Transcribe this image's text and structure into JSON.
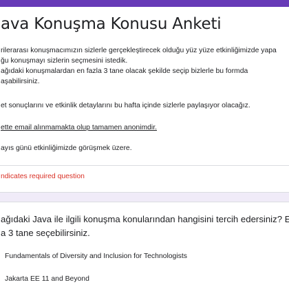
{
  "form": {
    "title": "ava Konuşma Konusu Anketi",
    "description_lines": [
      "rilerarası konuşmacımızın sizlerle gerçekleştirecek olduğu yüz yüze etkinliğimizde yapa",
      "ğu konuşmayı sizlerin seçmesini istedik.",
      "ağıdaki konuşmalardan en fazla 3 tane olacak şekilde seçip bizlerle bu formda",
      "aşabilirsiniz.",
      "et sonuçlarını ve etkinlik detaylarını bu hafta içinde sizlerle paylaşıyor olacağız.",
      "ette email alınmamakta olup tamamen anonimdir.",
      "ayıs günü etkinliğimizde görüşmek üzere."
    ],
    "required_note": "ndicates required question",
    "accent_color": "#673ab7",
    "required_color": "#d93025"
  },
  "question": {
    "text_lines": [
      "ağıdaki Java ile ilgili konuşma konularından hangisini tercih edersiniz? En",
      "a 3 tane seçebilirsiniz."
    ],
    "options": [
      "Fundamentals of Diversity and Inclusion for Technologists",
      "Jakarta EE 11 and Beyond"
    ]
  }
}
